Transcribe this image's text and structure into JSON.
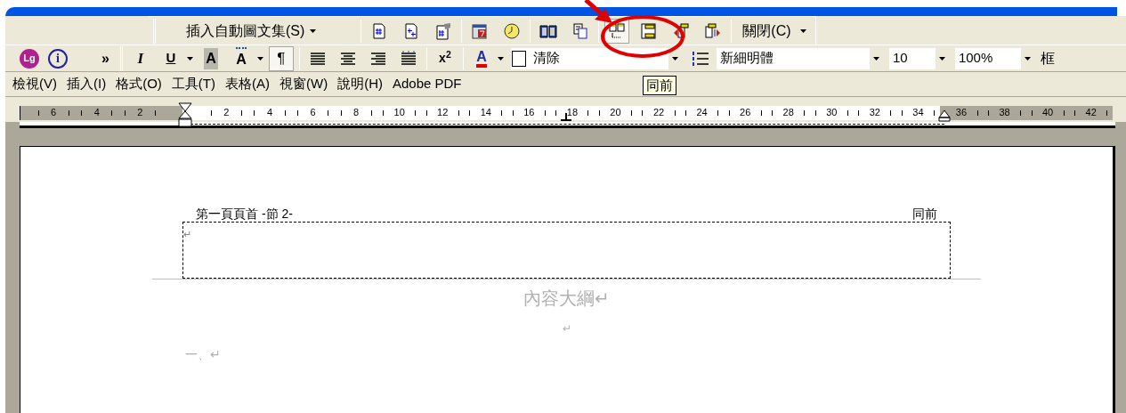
{
  "header_footer_toolbar": {
    "autotext_button": {
      "label": "插入自動圖文集(S)",
      "dropdown": true
    },
    "tool_groups": [
      [
        {
          "kind": "page-number",
          "selected": false
        },
        {
          "kind": "page-count",
          "selected": false
        },
        {
          "kind": "format-page-number",
          "selected": false
        }
      ],
      [
        {
          "kind": "date",
          "selected": false
        },
        {
          "kind": "time",
          "selected": false
        }
      ],
      [
        {
          "kind": "page-setup",
          "selected": false
        },
        {
          "kind": "show-text",
          "selected": false
        }
      ],
      [
        {
          "kind": "same-as-previous",
          "selected": true
        },
        {
          "kind": "switch",
          "selected": false
        },
        {
          "kind": "previous",
          "selected": false
        },
        {
          "kind": "next",
          "selected": false
        }
      ]
    ],
    "close_button": {
      "label": "關閉(C)",
      "dropdown": true
    }
  },
  "formatting_toolbar": {
    "lead_groups": [
      [
        {
          "kind": "logo",
          "label": "Lg"
        },
        {
          "kind": "info",
          "label": "i"
        },
        {
          "kind": "overflow",
          "label": "»"
        }
      ]
    ],
    "tool_groups": [
      [
        {
          "kind": "italic",
          "label": "I",
          "selected": false,
          "dropdown": false
        },
        {
          "kind": "underline",
          "label": "U",
          "selected": false,
          "dropdown": true
        },
        {
          "kind": "shaded",
          "label": "A",
          "selected": false,
          "dropdown": false
        },
        {
          "kind": "char-scale",
          "label": "A",
          "selected": false,
          "dropdown": true
        },
        {
          "kind": "pilcrow",
          "label": "¶",
          "selected": true,
          "dropdown": false
        }
      ],
      [
        {
          "kind": "justify",
          "selected": false,
          "dropdown": false
        },
        {
          "kind": "center",
          "selected": false,
          "dropdown": false
        },
        {
          "kind": "right",
          "selected": false,
          "dropdown": false
        },
        {
          "kind": "distribute",
          "selected": false,
          "dropdown": false
        }
      ],
      [
        {
          "kind": "superscript",
          "label": "x$^{2}$",
          "selected": false,
          "dropdown": false
        }
      ],
      [
        {
          "kind": "font-color",
          "label": "A",
          "selected": false,
          "dropdown": true
        }
      ]
    ],
    "style": "清除",
    "font": "新細明體",
    "size": "10",
    "zoom": "100%",
    "borders_label": "框"
  },
  "tooltip": "同前",
  "menu": [
    "檢視(V)",
    "插入(I)",
    "格式(O)",
    "工具(T)",
    "表格(A)",
    "視窗(W)",
    "說明(H)",
    "Adobe PDF"
  ],
  "ruler": {
    "left_numbers": [
      "6",
      "4",
      "2"
    ],
    "numbers": [
      "2",
      "4",
      "6",
      "8",
      "10",
      "12",
      "14",
      "16",
      "18",
      "20",
      "22",
      "24",
      "26",
      "28",
      "30",
      "32",
      "34"
    ],
    "right_numbers": [
      "36",
      "38",
      "40",
      "42"
    ]
  },
  "document": {
    "header_label": "第一頁頁首 -節 2-",
    "header_right_label": "同前",
    "header_mark": "↵",
    "title": "內容大綱↵",
    "blank_mark": "↵",
    "list_item": "一、↵"
  }
}
